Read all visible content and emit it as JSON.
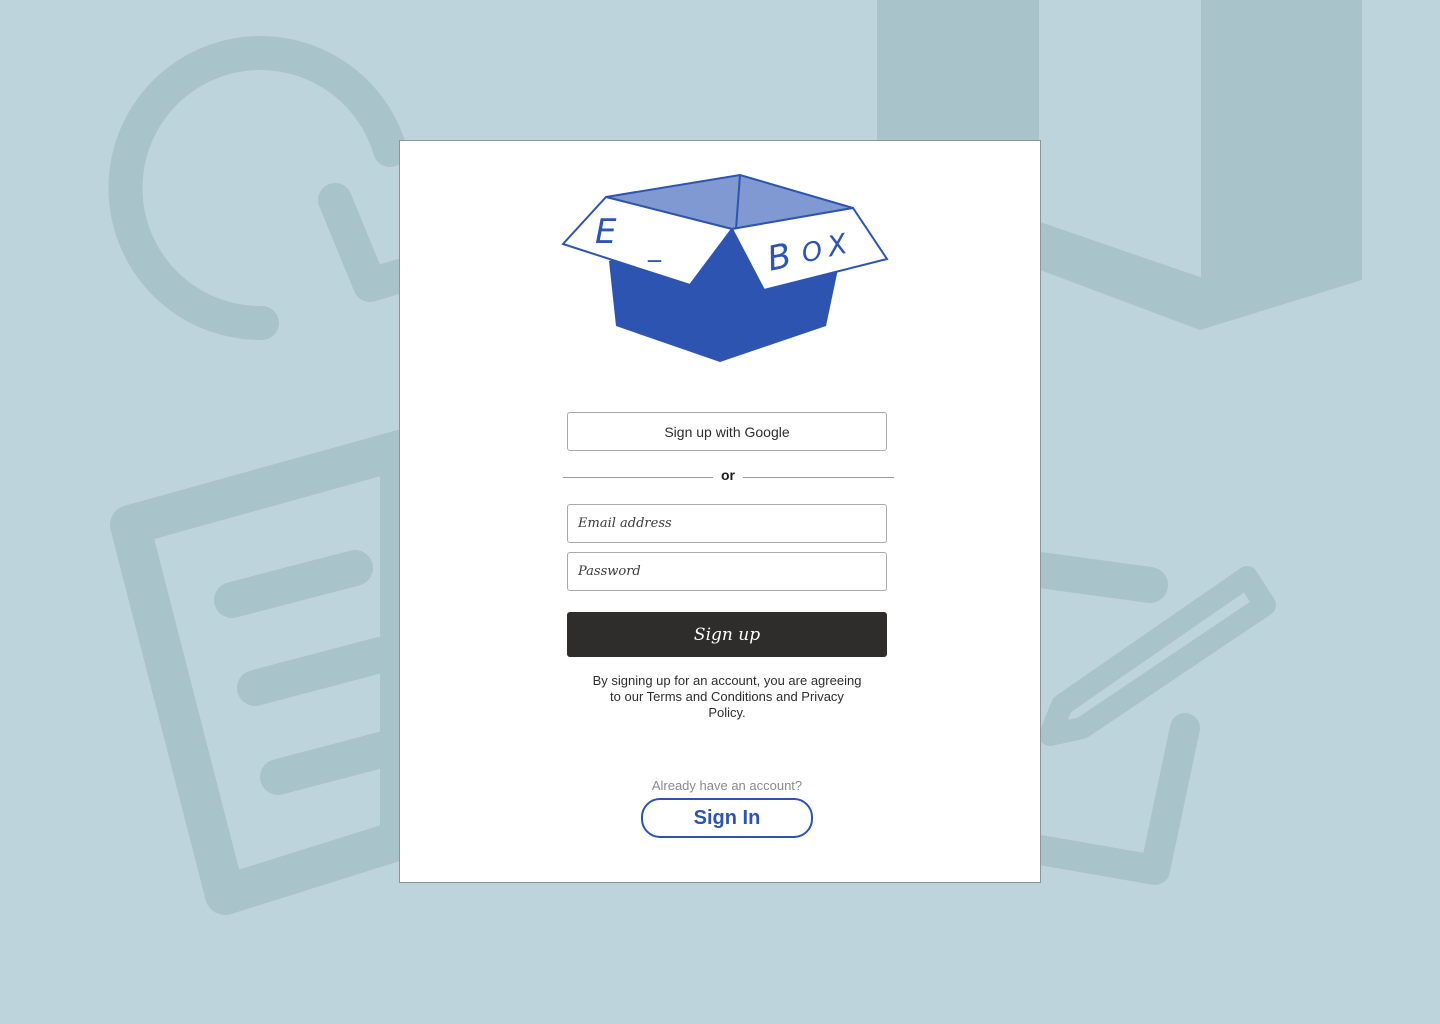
{
  "colors": {
    "background": "#bdd4dd",
    "background_art": "#a9c3ca",
    "card": "#ffffff",
    "brand": "#2e54b2",
    "brand_light": "#8099d3",
    "button_dark": "#2f2c2c"
  },
  "logo": {
    "icon": "open-box-icon",
    "letters": [
      "E",
      "_",
      "B",
      "O",
      "X"
    ]
  },
  "auth": {
    "google_label": "Sign up with Google",
    "divider_label": "or",
    "email_placeholder": "Email address",
    "password_placeholder": "Password",
    "submit_label": "Sign up",
    "terms_text": "By signing up for an account, you are agreeing to our Terms and Conditions and Privacy Policy."
  },
  "signin": {
    "prompt": "Already have an account?",
    "button_label": "Sign In"
  },
  "background_icons": [
    "search-icon",
    "document-icon",
    "book-icon",
    "pencil-icon"
  ]
}
